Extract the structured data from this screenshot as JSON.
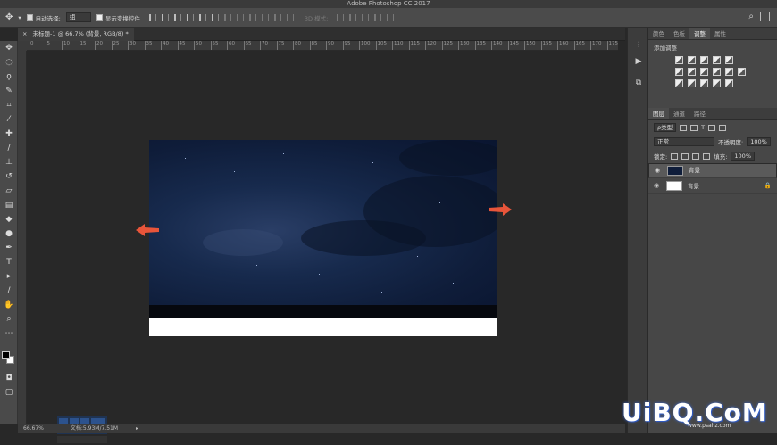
{
  "app": {
    "title": "Adobe Photoshop CC 2017"
  },
  "options": {
    "auto_select_label": "自动选择:",
    "auto_select_value": "组",
    "show_transform_label": "显示变换控件",
    "mode_3d_label": "3D 模式:"
  },
  "document": {
    "tab_label": "未标题-1 @ 66.7% (背景, RGB/8) *"
  },
  "rulers": {
    "h_ticks": [
      "0",
      "5",
      "10",
      "15",
      "20",
      "25",
      "30",
      "35",
      "40",
      "45",
      "50",
      "55",
      "60",
      "65",
      "70",
      "75",
      "80",
      "85",
      "90",
      "95",
      "100",
      "105",
      "110",
      "115",
      "120",
      "125",
      "130",
      "135",
      "140",
      "145",
      "150",
      "155",
      "160",
      "165",
      "170",
      "175"
    ]
  },
  "status": {
    "zoom": "66.67%",
    "doc_size": "文档:5.93M/7.51M"
  },
  "panels": {
    "top_tabs": [
      "颜色",
      "色板",
      "调整",
      "属性"
    ],
    "active_top_tab": "调整",
    "adjustments_title": "添加调整",
    "layer_tabs": [
      "图层",
      "通道",
      "路径"
    ],
    "filter_kind": "ρ类型",
    "blend_mode": "正常",
    "opacity_label": "不透明度:",
    "opacity_value": "100%",
    "lock_label": "锁定:",
    "fill_label": "填充:",
    "fill_value": "100%",
    "layers": [
      {
        "name": "背景",
        "thumb_color": "#0f1d3a",
        "selected": true
      },
      {
        "name": "背景",
        "thumb_color": "#ffffff",
        "selected": false,
        "locked": true
      }
    ]
  },
  "watermark": {
    "text": "UiBQ.CoM",
    "sub": "www.psahz.com"
  },
  "colors": {
    "arrow": "#e8553a",
    "foreground": "#000000",
    "background": "#ffffff"
  }
}
